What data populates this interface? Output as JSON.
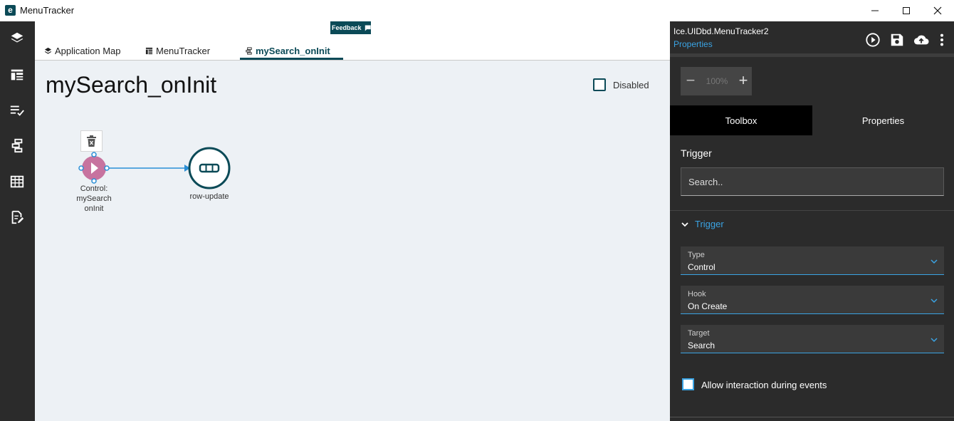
{
  "window": {
    "logo_letter": "e",
    "title": "MenuTracker"
  },
  "nav": {
    "items": [
      "layers-icon",
      "layout-icon",
      "checklist-icon",
      "flow-icon",
      "table-icon",
      "form-edit-icon"
    ]
  },
  "tabs": [
    {
      "label": "Application Map",
      "icon": "layers-icon"
    },
    {
      "label": "MenuTracker",
      "icon": "layout-icon"
    },
    {
      "label": "mySearch_onInit",
      "icon": "flow-icon",
      "active": true
    }
  ],
  "feedback": {
    "label": "Feedback"
  },
  "canvas": {
    "title": "mySearch_onInit",
    "disabled_label": "Disabled",
    "nodes": [
      {
        "label_lines": [
          "Control:",
          "mySearch",
          "onInit"
        ],
        "type": "trigger",
        "color": "#c7739f"
      },
      {
        "label_lines": [
          "row-update"
        ],
        "type": "action",
        "color": "#0b4a57"
      }
    ]
  },
  "panel": {
    "object_name": "Ice.UIDbd.MenuTracker2",
    "properties_link": "Properties",
    "zoom": {
      "value": "100%"
    },
    "tabs": {
      "toolbox": "Toolbox",
      "properties": "Properties"
    },
    "section_label": "Trigger",
    "search_placeholder": "Search..",
    "group_label": "Trigger",
    "fields": [
      {
        "label": "Type",
        "value": "Control"
      },
      {
        "label": "Hook",
        "value": "On Create"
      },
      {
        "label": "Target",
        "value": "Search"
      }
    ],
    "checkbox_label": "Allow interaction during events"
  },
  "colors": {
    "accent": "#0b4a57",
    "link": "#3aa3e3",
    "trigger_node": "#c7739f",
    "panel_bg": "#2b2b2b"
  }
}
